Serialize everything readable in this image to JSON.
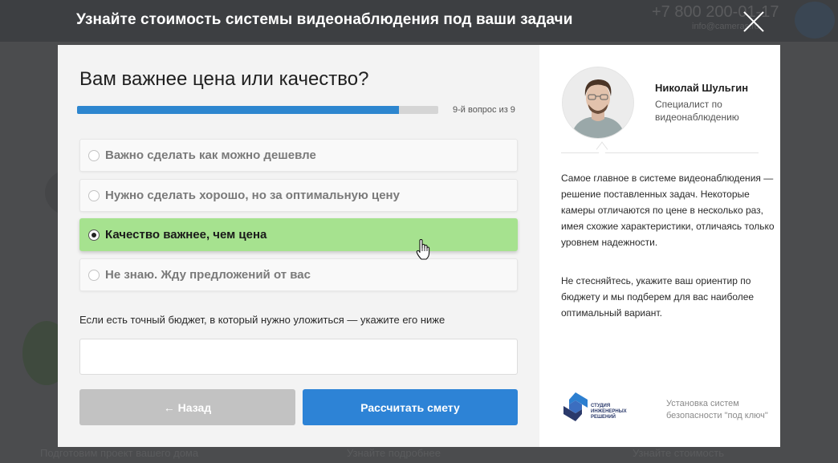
{
  "overlay": {
    "title": "Узнайте стоимость системы видеонаблюдения под ваши задачи",
    "close_icon": "close-icon"
  },
  "background": {
    "phone": "+7 800 200-01-17",
    "email": "info@cameras.ru",
    "bottom_links": [
      "Подготовим проект вашего дома",
      "Узнайте подробнее",
      "Узнайте стоимость"
    ]
  },
  "quiz": {
    "question": "Вам важнее цена или качество?",
    "progress": {
      "fraction": 0.89,
      "label": "9-й вопрос из 9"
    },
    "options": [
      {
        "label": "Важно сделать как можно дешевле",
        "selected": false
      },
      {
        "label": "Нужно сделать хорошо, но за оптимальную цену",
        "selected": false
      },
      {
        "label": "Качество важнее, чем цена",
        "selected": true
      },
      {
        "label": "Не знаю. Жду предложений от вас",
        "selected": false
      }
    ],
    "budget": {
      "label": "Если есть точный бюджет, в который нужно уложиться — укажите его ниже",
      "value": "",
      "placeholder": ""
    },
    "back_label": "← Назад",
    "submit_label": "Рассчитать смету"
  },
  "expert": {
    "name": "Николай Шульгин",
    "role": "Специалист по видеонаблюдению",
    "paragraphs": [
      "Самое главное в системе видеонаблюдения — решение поставленных задач. Некоторые камеры отличаются по цене в несколько раз, имея схожие характеристики, отличаясь только уровнем надежности.",
      "Не стесняйтесь, укажите ваш ориентир по бюджету и мы подберем для вас наиболее оптимальный вариант."
    ]
  },
  "brand": {
    "caption": "СТУДИЯ ИНЖЕНЕРНЫХ РЕШЕНИЙ",
    "tagline": "Установка систем безопасности \"под ключ\""
  },
  "colors": {
    "progress": "#2d86cf",
    "selected_option": "#a6e28f",
    "primary_button": "#2d83d6",
    "back_button": "#c2c2c2"
  }
}
